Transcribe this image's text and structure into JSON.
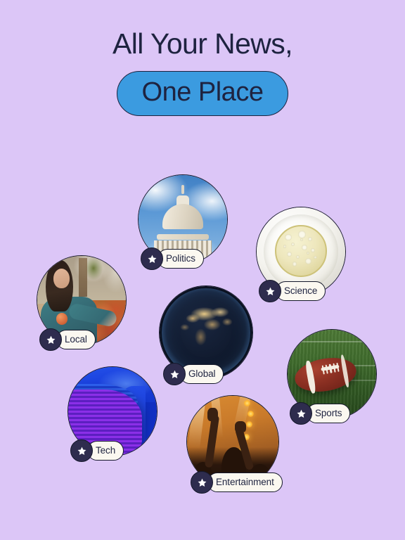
{
  "page": {
    "background_color": "#dcc6f7",
    "text_color": "#1e2340",
    "accent_color": "#3b9be0",
    "badge_color": "#2e2c4e",
    "pill_color": "#fbf8f0"
  },
  "header": {
    "line1": "All Your News,",
    "cta_label": "One Place"
  },
  "categories": [
    {
      "id": "politics",
      "label": "Politics",
      "badge_icon": "star-icon",
      "image_description": "United States Capitol dome against blue sky with clouds"
    },
    {
      "id": "science",
      "label": "Science",
      "badge_icon": "star-icon",
      "image_description": "Petri dish with pale yellow culture medium and bubbles"
    },
    {
      "id": "local",
      "label": "Local",
      "badge_icon": "star-icon",
      "image_description": "Woman in denim jacket selecting fruit at an outdoor farmers market"
    },
    {
      "id": "global",
      "label": "Global",
      "badge_icon": "star-icon",
      "image_description": "Planet Earth at night showing city lights across Europe and Africa"
    },
    {
      "id": "sports",
      "label": "Sports",
      "badge_icon": "star-icon",
      "image_description": "American football resting on a green grass field with yard lines"
    },
    {
      "id": "tech",
      "label": "Tech",
      "badge_icon": "star-icon",
      "image_description": "Abstract blue and purple gradient with horizontal scan lines"
    },
    {
      "id": "entertainment",
      "label": "Entertainment",
      "badge_icon": "star-icon",
      "image_description": "Concert crowd silhouettes with raised hands under orange stage lights"
    }
  ]
}
